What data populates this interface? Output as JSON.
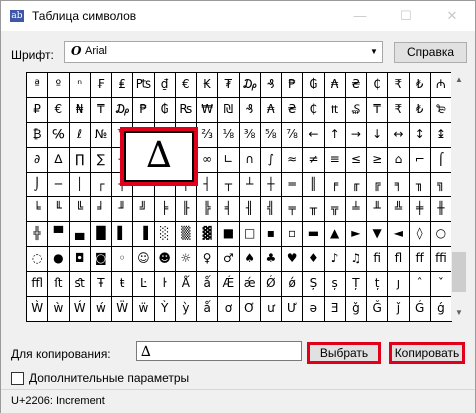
{
  "window": {
    "title": "Таблица символов",
    "app_icon_text": "ab",
    "minimize_glyph": "—",
    "maximize_glyph": "☐",
    "close_glyph": "✕"
  },
  "font": {
    "label": "Шрифт:",
    "icon_glyph": "O",
    "selected": "Arial",
    "help_button": "Справка"
  },
  "grid": {
    "cells": [
      "ª",
      "º",
      "ⁿ",
      "₣",
      "₤",
      "₧",
      "₫",
      "€",
      "₭",
      "₮",
      "₯",
      "₰",
      "₱",
      "₲",
      "₳",
      "₴",
      "₵",
      "₹",
      "₺",
      "₼",
      "₽",
      "€",
      "₦",
      "₸",
      "₯",
      "₱",
      "₲",
      "₨",
      "₩",
      "₪",
      "₰",
      "₳",
      "₴",
      "₵",
      "₶",
      "₷",
      "₸",
      "₹",
      "₺",
      "₻",
      "₿",
      "℅",
      "ℓ",
      "№",
      "™",
      "Ω",
      "℮",
      "⅓",
      "⅔",
      "⅛",
      "⅜",
      "⅝",
      "⅞",
      "←",
      "↑",
      "→",
      "↓",
      "↔",
      "↕",
      "↨",
      "∂",
      "∆",
      "∏",
      "∑",
      "−",
      "∕",
      "∙",
      "√",
      "∞",
      "∟",
      "∩",
      "∫",
      "≈",
      "≠",
      "≡",
      "≤",
      "≥",
      "⌂",
      "⌐",
      "⌠",
      "⌡",
      "─",
      "│",
      "┌",
      "┐",
      "└",
      "┘",
      "├",
      "┤",
      "┬",
      "┴",
      "┼",
      "═",
      "║",
      "╒",
      "╓",
      "╔",
      "╕",
      "╖",
      "╗",
      "╘",
      "╙",
      "╚",
      "╛",
      "╜",
      "╝",
      "╞",
      "╟",
      "╠",
      "╡",
      "╢",
      "╣",
      "╤",
      "╥",
      "╦",
      "╧",
      "╨",
      "╩",
      "╪",
      "╫",
      "╬",
      "▀",
      "▄",
      "█",
      "▌",
      "▐",
      "░",
      "▒",
      "▓",
      "■",
      "□",
      "▪",
      "▫",
      "▬",
      "▲",
      "►",
      "▼",
      "◄",
      "◊",
      "○",
      "◌",
      "●",
      "◘",
      "◙",
      "◦",
      "☺",
      "☻",
      "☼",
      "♀",
      "♂",
      "♠",
      "♣",
      "♥",
      "♦",
      "♪",
      "♫",
      "ﬁ",
      "ﬂ",
      "ﬀ",
      "ﬃ",
      "ﬄ",
      "ﬅ",
      "ﬆ",
      "Ŧ",
      "ŧ",
      "Ŀ",
      "ŀ",
      "Ǻ",
      "ǻ",
      "Ǽ",
      "ǽ",
      "Ǿ",
      "ǿ",
      "Ș",
      "ș",
      "Ț",
      "ț",
      "ȷ",
      "ˆ",
      "ˇ",
      "Ẁ",
      "ẁ",
      "Ẃ",
      "ẃ",
      "Ẅ",
      "ẅ",
      "Ỳ",
      "ỳ",
      "ǻ",
      "ơ",
      "Ơ",
      "ư",
      "Ư",
      "ǝ",
      "Ǝ",
      "ǧ",
      "Ǧ",
      "ǰ",
      "Ǵ",
      "ǵ"
    ],
    "zoomed_char": "∆"
  },
  "copy": {
    "label": "Для копирования:",
    "value": "∆",
    "select_button": "Выбрать",
    "copy_button": "Копировать"
  },
  "advanced": {
    "label": "Дополнительные параметры"
  },
  "status": {
    "text": "U+2206: Increment"
  },
  "scrollbar": {
    "up_glyph": "▲",
    "down_glyph": "▼"
  },
  "colors": {
    "highlight": "#e0001b",
    "accent": "#3f57a7"
  }
}
